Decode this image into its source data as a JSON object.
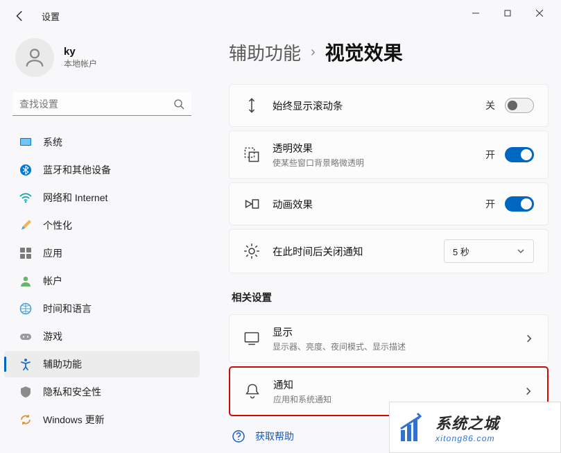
{
  "app_title": "设置",
  "user": {
    "name": "ky",
    "subtitle": "本地帐户"
  },
  "search": {
    "placeholder": "查找设置"
  },
  "sidebar": {
    "items": [
      {
        "label": "系统"
      },
      {
        "label": "蓝牙和其他设备"
      },
      {
        "label": "网络和 Internet"
      },
      {
        "label": "个性化"
      },
      {
        "label": "应用"
      },
      {
        "label": "帐户"
      },
      {
        "label": "时间和语言"
      },
      {
        "label": "游戏"
      },
      {
        "label": "辅助功能"
      },
      {
        "label": "隐私和安全性"
      },
      {
        "label": "Windows 更新"
      }
    ]
  },
  "breadcrumb": {
    "parent": "辅助功能",
    "current": "视觉效果"
  },
  "settings": {
    "scrollbar": {
      "title": "始终显示滚动条",
      "state": "关",
      "on": false
    },
    "transparency": {
      "title": "透明效果",
      "subtitle": "使某些窗口背景略微透明",
      "state": "开",
      "on": true
    },
    "animation": {
      "title": "动画效果",
      "state": "开",
      "on": true
    },
    "dismiss": {
      "title": "在此时间后关闭通知",
      "value": "5 秒"
    }
  },
  "related": {
    "heading": "相关设置",
    "display": {
      "title": "显示",
      "subtitle": "显示器、亮度、夜间模式、显示描述"
    },
    "notify": {
      "title": "通知",
      "subtitle": "应用和系统通知"
    }
  },
  "help": {
    "label": "获取帮助"
  },
  "watermark": {
    "line1": "系统之城",
    "line2": "xitong86.com"
  }
}
